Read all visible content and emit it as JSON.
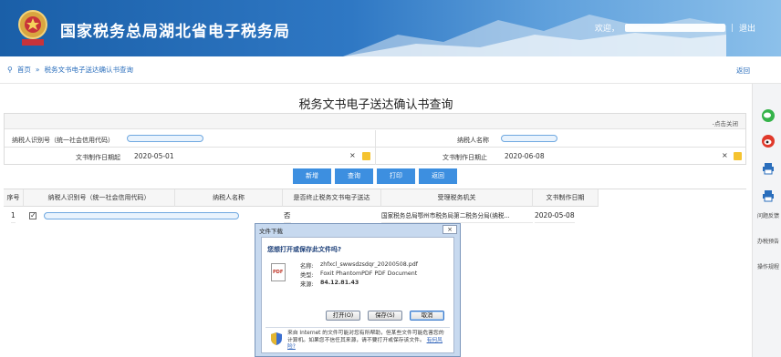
{
  "header": {
    "site_title": "国家税务总局湖北省电子税务局",
    "welcome": "欢迎，",
    "separator": "|",
    "logout": "退出",
    "colors": {
      "header_blue": "#1a5fa8",
      "accent": "#3d8fe0"
    }
  },
  "breadcrumb": {
    "home": "首页",
    "separator": "»",
    "current": "税务文书电子送达确认书查询",
    "back": "返回"
  },
  "page": {
    "title": "税务文书电子送达确认书查询",
    "collapse": "-点击关闭"
  },
  "form": {
    "taxpayer_id_label": "纳税人识别号（统一社会信用代码）",
    "taxpayer_name_label": "纳税人名称",
    "date_start_label": "文书制作日期起",
    "date_start_value": "2020-05-01",
    "date_end_label": "文书制作日期止",
    "date_end_value": "2020-06-08",
    "clear_symbol": "×"
  },
  "buttons": {
    "add": "新增",
    "query": "查询",
    "print": "打印",
    "back": "返回"
  },
  "table": {
    "columns": [
      "序号",
      "纳税人识别号（统一社会信用代码）",
      "纳税人名称",
      "是否终止税务文书电子送达",
      "受理税务机关",
      "文书制作日期"
    ],
    "rows": [
      {
        "index": "1",
        "checked": "✓",
        "terminated": "否",
        "authority": "国家税务总局鄂州市税务局第二税务分局(纳税...",
        "date": "2020-05-08"
      }
    ]
  },
  "dialog": {
    "title": "文件下载",
    "close": "×",
    "question": "您想打开或保存此文件吗?",
    "file_icon_label": "PDF",
    "name_label": "名称:",
    "name_value": "zhfxcl_swwsdzsdqr_20200508.pdf",
    "type_label": "类型:",
    "type_value": "Foxit PhantomPDF PDF Document",
    "source_label": "来源:",
    "source_value": "84.12.81.43",
    "open_button": "打开(O)",
    "save_button": "保存(S)",
    "cancel_button": "取消",
    "warning": "来自 Internet 的文件可能对您有所帮助，但某些文件可能危害您的计算机。如果您不信任其来源，请不要打开或保存该文件。",
    "risk_link": "有何风险?"
  },
  "sidebar": {
    "items": [
      {
        "icon": "wechat-icon"
      },
      {
        "icon": "weibo-icon"
      },
      {
        "icon": "printer-icon"
      },
      {
        "icon": "printer-icon"
      },
      {
        "label": "问题反馈"
      },
      {
        "label": "办税预告"
      },
      {
        "label": "操作规程"
      }
    ]
  }
}
